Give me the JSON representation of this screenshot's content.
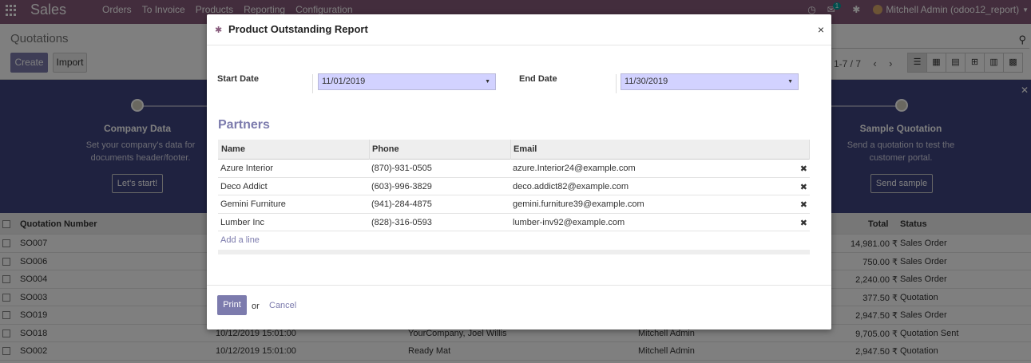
{
  "navbar": {
    "brand": "Sales",
    "menu": [
      "Orders",
      "To Invoice",
      "Products",
      "Reporting",
      "Configuration"
    ],
    "chat_badge": "1",
    "user": "Mitchell Admin (odoo12_report)"
  },
  "control_panel": {
    "title": "Quotations",
    "create_label": "Create",
    "import_label": "Import",
    "pager": "1-7 / 7"
  },
  "banner": {
    "step1_title": "Company Data",
    "step1_desc": "Set your company's data for documents header/footer.",
    "step1_button": "Let's start!",
    "step2_title": "Sample Quotation",
    "step2_desc": "Send a quotation to test the customer portal.",
    "step2_button": "Send sample"
  },
  "list": {
    "columns": {
      "number": "Quotation Number",
      "total": "Total",
      "status": "Status"
    },
    "rows": [
      {
        "number": "SO007",
        "date": "",
        "customer": "",
        "salesperson": "",
        "total": "14,981.00 ₹",
        "status": "Sales Order"
      },
      {
        "number": "SO006",
        "date": "",
        "customer": "",
        "salesperson": "",
        "total": "750.00 ₹",
        "status": "Sales Order"
      },
      {
        "number": "SO004",
        "date": "",
        "customer": "",
        "salesperson": "",
        "total": "2,240.00 ₹",
        "status": "Sales Order"
      },
      {
        "number": "SO003",
        "date": "",
        "customer": "",
        "salesperson": "",
        "total": "377.50 ₹",
        "status": "Quotation"
      },
      {
        "number": "SO019",
        "date": "",
        "customer": "",
        "salesperson": "",
        "total": "2,947.50 ₹",
        "status": "Sales Order"
      },
      {
        "number": "SO018",
        "date": "10/12/2019 15:01:00",
        "customer": "YourCompany, Joel Willis",
        "salesperson": "Mitchell Admin",
        "total": "9,705.00 ₹",
        "status": "Quotation Sent"
      },
      {
        "number": "SO002",
        "date": "10/12/2019 15:01:00",
        "customer": "Ready Mat",
        "salesperson": "Mitchell Admin",
        "total": "2,947.50 ₹",
        "status": "Quotation"
      }
    ]
  },
  "modal": {
    "title": "Product Outstanding Report",
    "close_glyph": "×",
    "start_date_label": "Start Date",
    "start_date_value": "11/01/2019",
    "end_date_label": "End Date",
    "end_date_value": "11/30/2019",
    "section_title": "Partners",
    "table_headers": {
      "name": "Name",
      "phone": "Phone",
      "email": "Email"
    },
    "partners": [
      {
        "name": "Azure Interior",
        "phone": "(870)-931-0505",
        "email": "azure.Interior24@example.com"
      },
      {
        "name": "Deco Addict",
        "phone": "(603)-996-3829",
        "email": "deco.addict82@example.com"
      },
      {
        "name": "Gemini Furniture",
        "phone": "(941)-284-4875",
        "email": "gemini.furniture39@example.com"
      },
      {
        "name": "Lumber Inc",
        "phone": "(828)-316-0593",
        "email": "lumber-inv92@example.com"
      }
    ],
    "add_line": "Add a line",
    "print_label": "Print",
    "or_text": "or",
    "cancel_label": "Cancel"
  },
  "colors": {
    "navbar": "#875a7b",
    "primary": "#7c7bad",
    "banner": "#3f4480",
    "date_field_bg": "#d2d2ff"
  }
}
